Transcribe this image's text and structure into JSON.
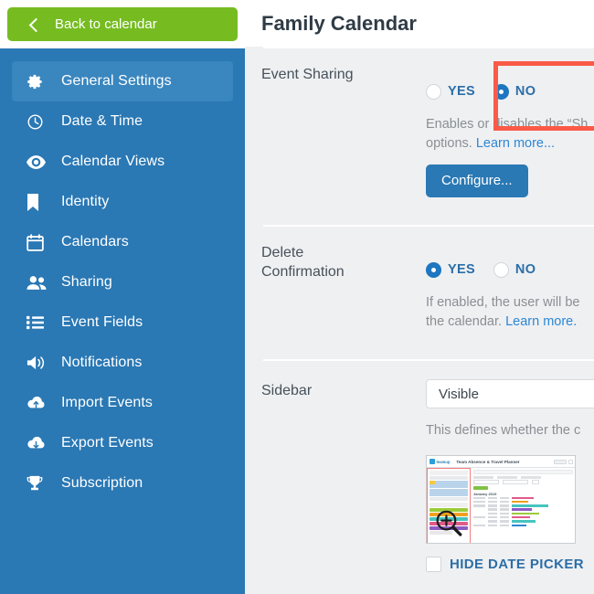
{
  "sidebar": {
    "back_button": {
      "label": "Back to calendar",
      "icon": "chevron-left-icon"
    },
    "items": [
      {
        "label": "General Settings",
        "icon": "gear-icon",
        "active": true
      },
      {
        "label": "Date & Time",
        "icon": "clock-icon",
        "active": false
      },
      {
        "label": "Calendar Views",
        "icon": "eye-icon",
        "active": false
      },
      {
        "label": "Identity",
        "icon": "bookmark-icon",
        "active": false
      },
      {
        "label": "Calendars",
        "icon": "calendar-icon",
        "active": false
      },
      {
        "label": "Sharing",
        "icon": "users-icon",
        "active": false
      },
      {
        "label": "Event Fields",
        "icon": "list-icon",
        "active": false
      },
      {
        "label": "Notifications",
        "icon": "speaker-icon",
        "active": false
      },
      {
        "label": "Import Events",
        "icon": "cloud-upload-icon",
        "active": false
      },
      {
        "label": "Export Events",
        "icon": "cloud-download-icon",
        "active": false
      },
      {
        "label": "Subscription",
        "icon": "trophy-icon",
        "active": false
      }
    ]
  },
  "header": {
    "title": "Family Calendar"
  },
  "settings": {
    "event_sharing": {
      "label": "Event Sharing",
      "options": [
        {
          "label": "YES",
          "selected": false
        },
        {
          "label": "NO",
          "selected": true
        }
      ],
      "description_line1": "Enables or disables the “Sh",
      "description_line2_prefix": "options. ",
      "description_link": "Learn more...",
      "button_label": "Configure..."
    },
    "delete_confirmation": {
      "label": "Delete Confirmation",
      "label_line1": "Delete",
      "label_line2": "Confirmation",
      "options": [
        {
          "label": "YES",
          "selected": true
        },
        {
          "label": "NO",
          "selected": false
        }
      ],
      "description_line1": "If enabled, the user will be",
      "description_line2_prefix": "the calendar. ",
      "description_link": "Learn more."
    },
    "sidebar_setting": {
      "label": "Sidebar",
      "selected_value": "Visible",
      "options": [
        "Visible"
      ],
      "description": "This defines whether the c",
      "preview": {
        "name": "calendar-preview-thumbnail",
        "logo_text": "teamup",
        "title_text": "Team Absence & Travel Planner",
        "month_text": "January 2019",
        "magnifier_icon": "magnify-plus-icon"
      },
      "hide_date_picker": {
        "label": "HIDE DATE PICKER",
        "checked": false
      }
    }
  },
  "annotation": {
    "highlight_color": "#fa5a47",
    "target": "event-sharing-row"
  },
  "colors": {
    "sidebar_bg": "#2a78b4",
    "sidebar_active": "#3a86bf",
    "back_button": "#76bc21",
    "accent_blue": "#2a79b4",
    "link_blue": "#2d87d4",
    "radio_label": "#2b6ea8",
    "content_bg": "#eff0f2",
    "highlight_red": "#fa5a47"
  }
}
